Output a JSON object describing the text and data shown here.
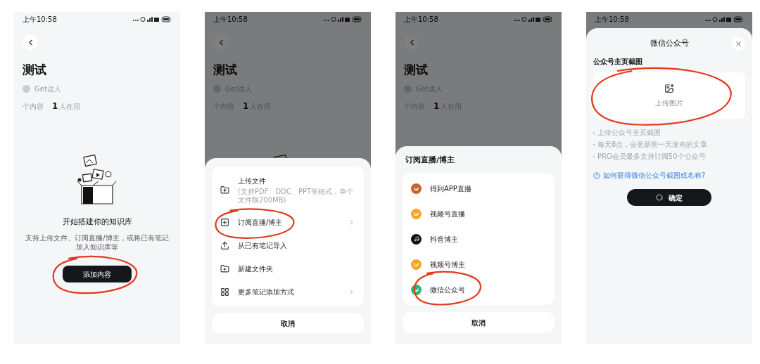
{
  "phones": [
    {
      "status_time": "上午10:58",
      "dimmed": false,
      "page": {
        "title": "测试",
        "author": "Get达人",
        "content_label": "个内容",
        "users_count": "1",
        "users_label": "人在用"
      },
      "illustration": true,
      "empty_state": {
        "heading": "开始搭建你的知识库",
        "description": "支持上传文件、订阅直播/博主，或将已有笔记加入知识库等",
        "button": "添加内容"
      }
    },
    {
      "status_time": "上午10:58",
      "dimmed": true,
      "page": {
        "title": "测试",
        "author": "Get达人",
        "content_label": "个内容",
        "users_count": "1",
        "users_label": "人在用"
      },
      "illustration": true,
      "sheet": {
        "kind": "add_menu",
        "items": [
          {
            "label": "上传文件",
            "sublabel": "(支持PDF、DOC、PPT等格式，单个文件限200MB)",
            "chevron": false
          },
          {
            "label": "订阅直播/博主",
            "chevron": true
          },
          {
            "label": "从已有笔记导入",
            "chevron": false
          },
          {
            "label": "新建文件夹",
            "chevron": false
          },
          {
            "label": "更多笔记添加方式",
            "chevron": true
          }
        ],
        "cancel": "取消"
      }
    },
    {
      "status_time": "上午10:58",
      "dimmed": true,
      "page": {
        "title": "测试",
        "author": "Get达人",
        "content_label": "个内容",
        "users_count": "1",
        "users_label": "人在用"
      },
      "sheet": {
        "kind": "channels",
        "title": "订阅直播/博主",
        "items": [
          {
            "label": "得到APP直播",
            "color": "#c8642a"
          },
          {
            "label": "视频号直播",
            "color": "#f6a623"
          },
          {
            "label": "抖音博主",
            "color": "#111111"
          },
          {
            "label": "视频号博主",
            "color": "#f6a623"
          },
          {
            "label": "微信公众号",
            "color": "#2bb673"
          }
        ],
        "cancel": "取消"
      }
    },
    {
      "status_time": "上午10:58",
      "dimmed": true,
      "sheet": {
        "kind": "form",
        "title": "微信公众号",
        "section_label": "公众号主页截图",
        "upload_label": "上传图片",
        "notes": [
          "上传公众号主页截图",
          "每天8点，会更新前一天发布的文章",
          "PRO会员最多支持订阅50个公众号"
        ],
        "help_link": "如何获得微信公众号截图或名称?",
        "confirm": "确定"
      }
    }
  ]
}
